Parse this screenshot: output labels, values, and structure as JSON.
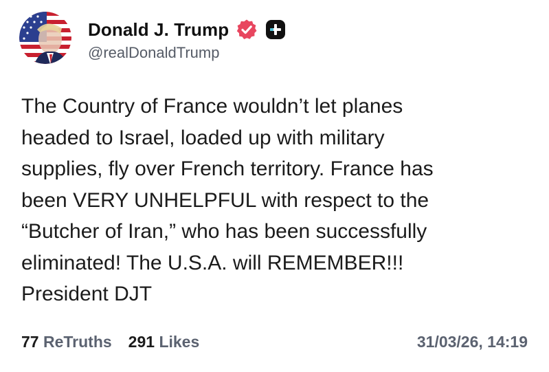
{
  "author": {
    "display_name": "Donald J. Trump",
    "handle": "@realDonaldTrump",
    "avatar_icon": "flag-portrait-avatar",
    "badges": [
      "verified-badge-icon",
      "plus-square-icon"
    ]
  },
  "post": {
    "text": "The Country of France wouldn’t let planes\nheaded to Israel, loaded up with military\nsupplies, fly over French territory. France has\nbeen VERY UNHELPFUL with respect to the\n“Butcher of Iran,” who has been successfully\neliminated! The U.S.A. will REMEMBER!!!\nPresident DJT"
  },
  "stats": {
    "retruths_count": "77",
    "retruths_label": "ReTruths",
    "likes_count": "291",
    "likes_label": "Likes"
  },
  "timestamp": "31/03/26, 14:19",
  "colors": {
    "verified": "#e8465f",
    "text": "#1b1b1b",
    "muted": "#5b6270",
    "badge_dark": "#111111"
  }
}
